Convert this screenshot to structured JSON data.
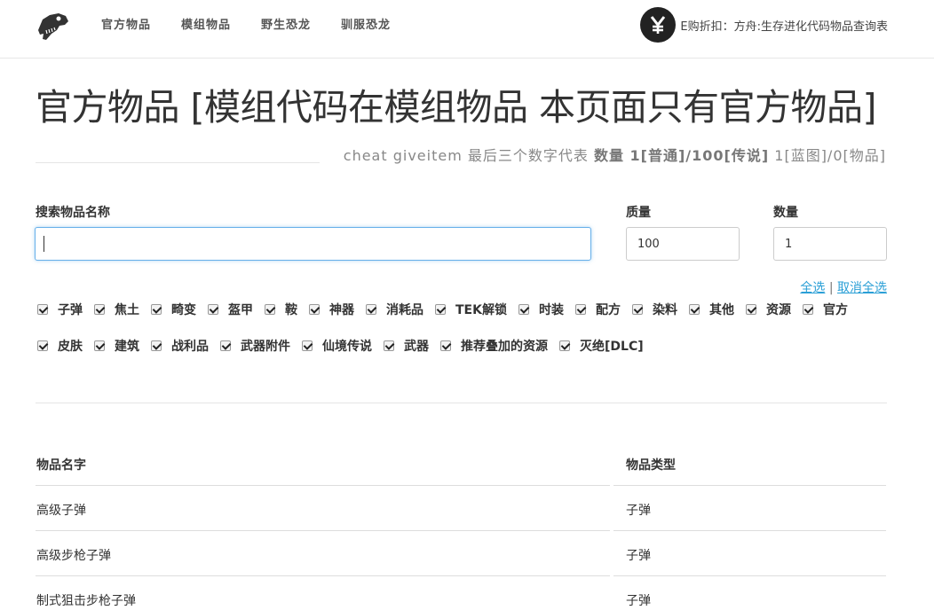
{
  "nav": {
    "links": [
      "官方物品",
      "模组物品",
      "野生恐龙",
      "驯服恐龙"
    ],
    "brand_text": "E购折扣：方舟:生存进化代码物品查询表"
  },
  "header": {
    "title": "官方物品 [模组代码在模组物品 本页面只有官方物品]",
    "sub_prefix": "cheat giveitem 最后三个数字代表",
    "sub_bold": "数量 1[普通]/100[传说]",
    "sub_suffix": "1[蓝图]/0[物品]"
  },
  "search": {
    "label": "搜索物品名称",
    "value": ""
  },
  "quality": {
    "label": "质量",
    "value": "100"
  },
  "quantity": {
    "label": "数量",
    "value": "1"
  },
  "select": {
    "all": "全选",
    "separator": "|",
    "none": "取消全选"
  },
  "categories_row1": [
    "子弹",
    "焦土",
    "畸变",
    "盔甲",
    "鞍",
    "神器",
    "消耗品",
    "TEK解锁",
    "时装",
    "配方",
    "染料",
    "其他",
    "资源",
    "官方"
  ],
  "categories_row2": [
    "皮肤",
    "建筑",
    "战利品",
    "武器附件",
    "仙境传说",
    "武器",
    "推荐叠加的资源",
    "灭绝[DLC]"
  ],
  "table": {
    "headers": [
      "物品名字",
      "物品类型"
    ],
    "rows": [
      [
        "高级子弹",
        "子弹"
      ],
      [
        "高级步枪子弹",
        "子弹"
      ],
      [
        "制式狙击步枪子弹",
        "子弹"
      ]
    ]
  }
}
